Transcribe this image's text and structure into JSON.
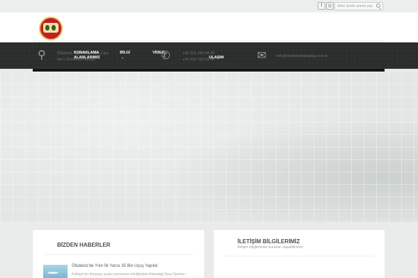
{
  "topbar": {
    "social": [
      {
        "icon": "facebook-icon",
        "glyph": "f"
      },
      {
        "icon": "instagram-icon",
        "glyph": "◎"
      }
    ],
    "search": {
      "placeholder": "Sitee içinde arama yap"
    }
  },
  "contact_strip": {
    "address_line1": "Ölüdeniz, Babadağ Kopu Cad.",
    "address_line2": "No:1 Ölüdeniz/Fethiye",
    "phone_line1": "+90 531 444 96 00",
    "phone_line2": "+90 532 202 56 48",
    "email": "info@oludenizbabadag.com.tr"
  },
  "nav": {
    "items": [
      {
        "label": "KONAKLAMA ALANLARIMIZ"
      },
      {
        "label": "BİLGİ",
        "caret": "⌄"
      },
      {
        "label": "VİDEO"
      },
      {
        "label": "ULAŞIM"
      }
    ]
  },
  "panels": {
    "news": {
      "title": "BİZDEN HABERLER",
      "items": [
        {
          "title": "Ölüdeniz'de Yılın İlk Yarısı 35 Bin Uçuş Yapıldı",
          "excerpt": "Fethiye'nin dünyaya açılan penceresi niteliğindeki Babadağ Hava Sporları"
        }
      ]
    },
    "contact": {
      "title": "İLETİŞİM BİLGİLERİMİZ",
      "subtitle": "İletişim bilgilerimize buradan ulaşabilirsiniz"
    }
  },
  "colors": {
    "nav_bg": "#2b2c2c",
    "page_bg": "#e6e9e7",
    "panel_bg": "#ffffff"
  }
}
